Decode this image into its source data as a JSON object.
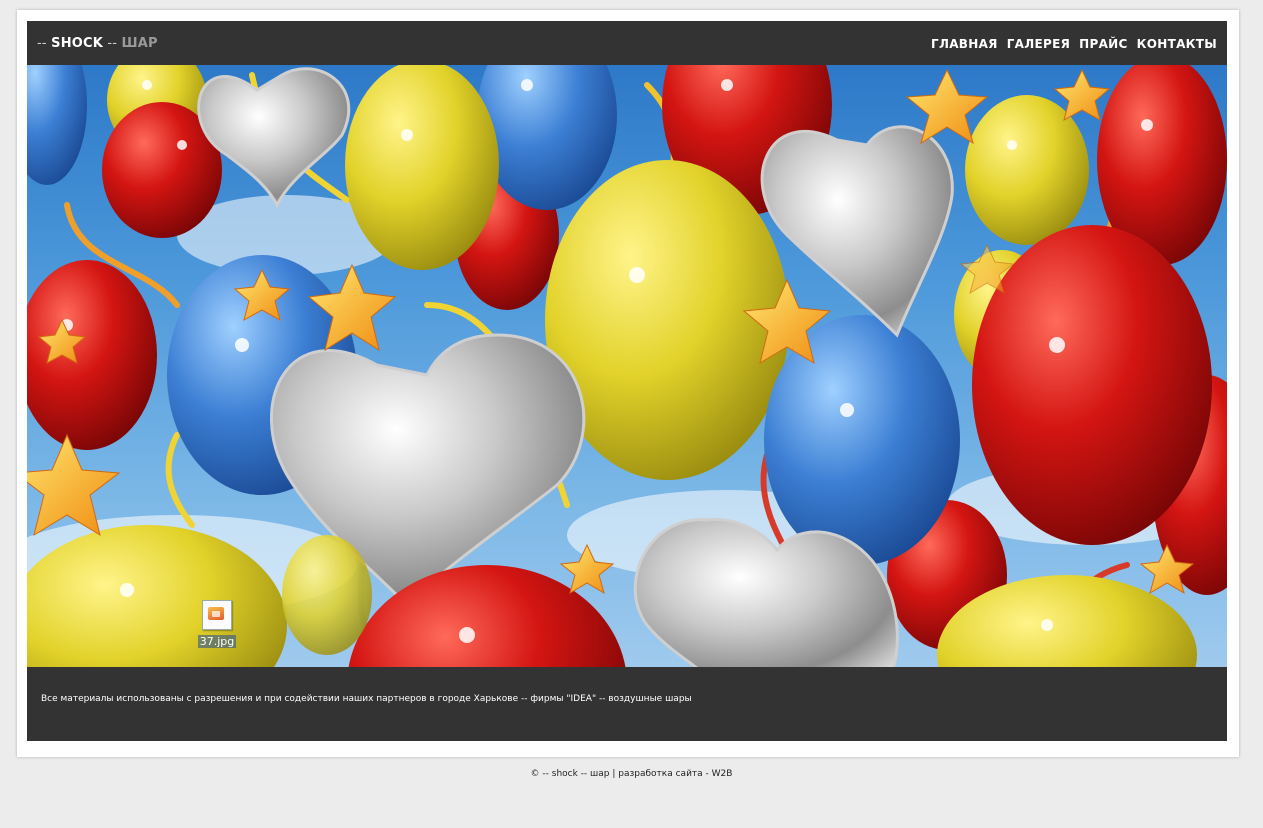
{
  "header": {
    "logo_prefix": "-- ",
    "logo_main": "SHOCK",
    "logo_separator": " -- ",
    "logo_sub": "ШАР"
  },
  "nav": {
    "items": [
      "ГЛАВНАЯ",
      "ГАЛЕРЕЯ",
      "ПРАЙС",
      "КОНТАКТЫ"
    ]
  },
  "banner": {
    "file_icon_name": "jpg-file-icon",
    "file_name": "37.jpg"
  },
  "footer": {
    "text": "Все материалы использованы с разрешения и при содействии наших партнеров в городе Харькове -- фирмы \"IDEA\" -- воздушные шары"
  },
  "copyright": {
    "text": "© -- shock -- шар | разработка сайта - W2B"
  },
  "colors": {
    "page_bg": "#ececec",
    "panel_bg": "#333333",
    "nav_text": "#ffffff",
    "logo_sub": "#9a9a9a"
  }
}
